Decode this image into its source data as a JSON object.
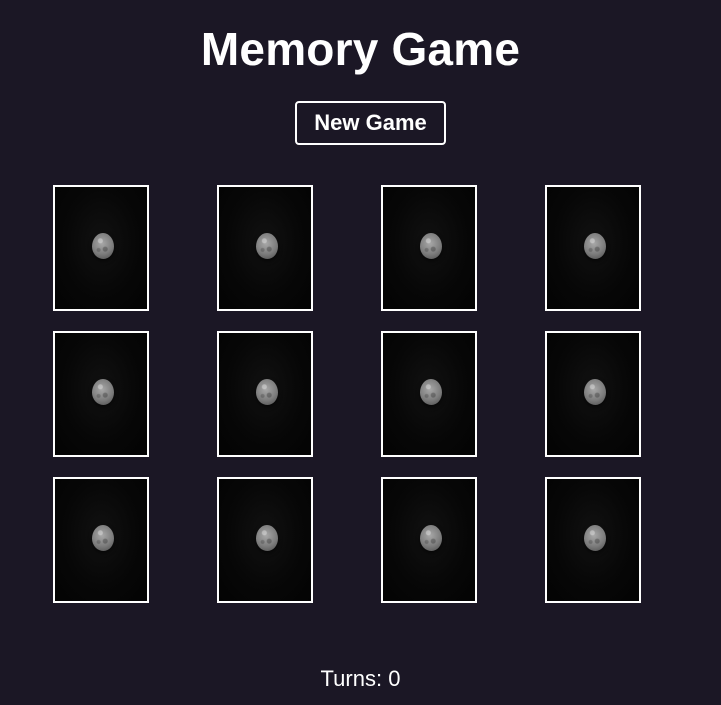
{
  "title": "Memory Game",
  "new_game_label": "New Game",
  "turns": {
    "label": "Turns: 0",
    "value": 0
  },
  "cards": {
    "columns": 4,
    "rows": 3,
    "face_down_count": 12,
    "back_icon": "stone-icon"
  },
  "colors": {
    "background": "#1b1725",
    "text": "#ffffff",
    "card_border": "#ffffff",
    "card_back": "#070707"
  }
}
